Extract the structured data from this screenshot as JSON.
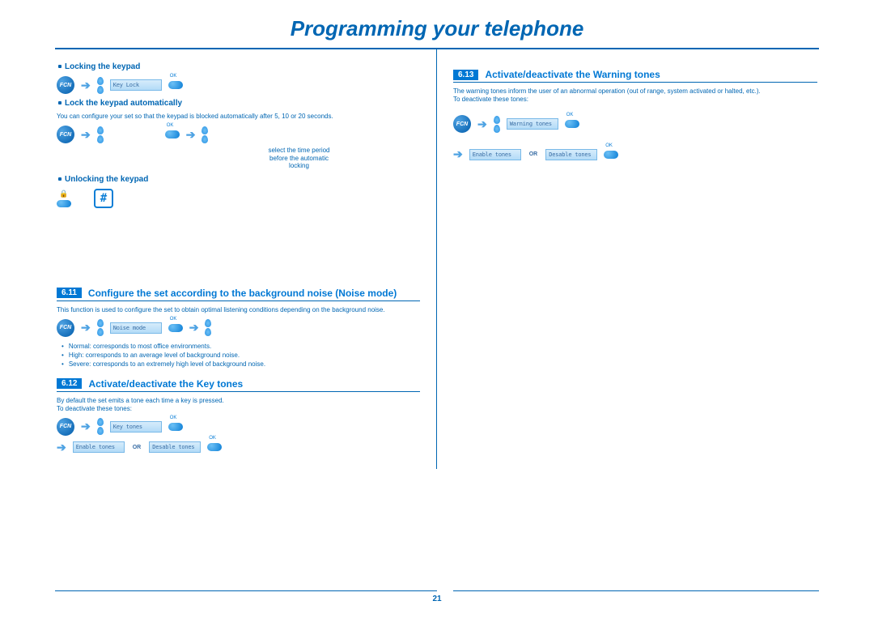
{
  "page": {
    "title": "Programming your telephone",
    "number": "21"
  },
  "left": {
    "sub1": "Locking the keypad",
    "sub2": "Lock the keypad automatically",
    "sub2_body": "You can configure your set so that the keypad is blocked automatically after 5, 10 or 20 seconds.",
    "sub3": "Unlocking the keypad",
    "note1": "select the time period before the automatic locking",
    "screen_keylock": "Key Lock",
    "screen_noise": "Noise mode",
    "screen_keytones": "Key tones",
    "screen_enable": "Enable tones",
    "screen_disable": "Desable tones",
    "or": "OR",
    "fcn": "FCN",
    "hash": "#",
    "sec611_num": "6.11",
    "sec611_title": "Configure the set according to the background noise (Noise mode)",
    "sec611_body": "This function is used to configure the set to obtain optimal listening conditions depending on the background noise.",
    "mode1": "Normal: corresponds to most office environments.",
    "mode2": "High: corresponds to an average level of background noise.",
    "mode3": "Severe: corresponds to an extremely high level of background noise.",
    "sec612_num": "6.12",
    "sec612_title": "Activate/deactivate the Key tones",
    "sec612_body1": "By default the set emits a tone each time a key is pressed.",
    "sec612_body2": "To deactivate these tones:"
  },
  "right": {
    "sec613_num": "6.13",
    "sec613_title": "Activate/deactivate the Warning tones",
    "sec613_body1": "The warning tones inform the user of an abnormal operation (out of range, system activated or halted, etc.).",
    "sec613_body2": "To deactivate these tones:",
    "screen_warning": "Warning tones",
    "screen_enable": "Enable tones",
    "screen_disable": "Desable tones"
  }
}
